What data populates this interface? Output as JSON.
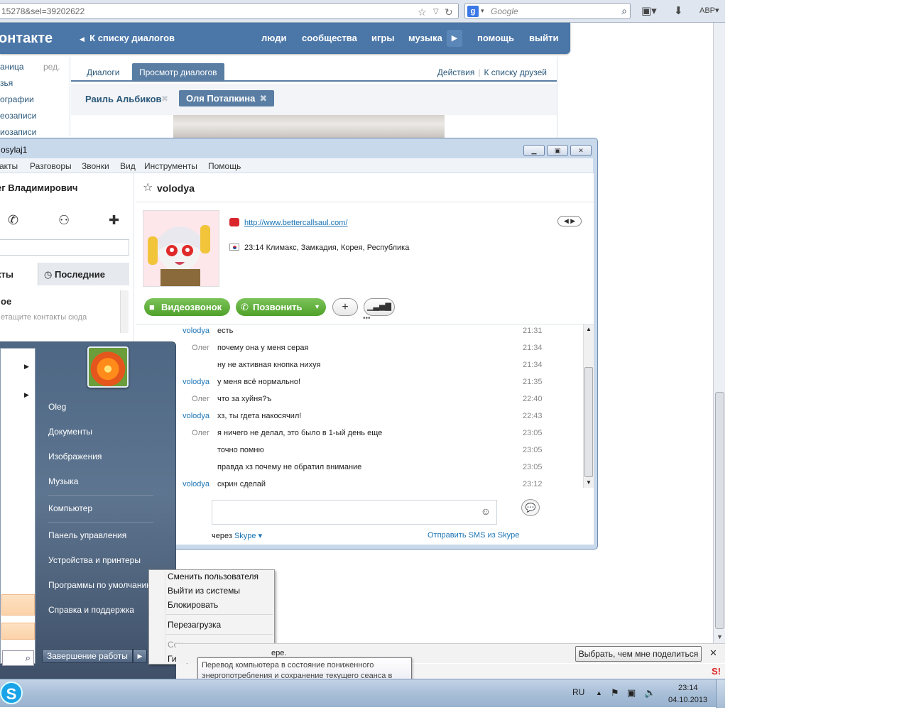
{
  "browser": {
    "url": "15278&sel=39202622",
    "search_placeholder": "Google",
    "search_engine_icon": "g"
  },
  "vk": {
    "logo": "онтакте",
    "back": "К списку диалогов",
    "nav": [
      "люди",
      "сообщества",
      "игры",
      "музыка",
      "помощь",
      "выйти"
    ],
    "left_menu": [
      "аница",
      "зья",
      "ографии",
      "еозаписи",
      "иозаписи"
    ],
    "edit": "ред.",
    "tabs": {
      "dialogs": "Диалоги",
      "view": "Просмотр диалогов"
    },
    "actions": "Действия",
    "friends": "К списку друзей",
    "people": [
      "Раиль Альбиков",
      "Оля Потапкина"
    ]
  },
  "skype": {
    "title": "osylaj1",
    "menu": [
      "акты",
      "Разговоры",
      "Звонки",
      "Вид",
      "Инструменты",
      "Помощь"
    ],
    "user": "ег Владимирович",
    "tabs": {
      "contacts": "кты",
      "recent": "Последние"
    },
    "favorites": "ое",
    "drag_hint": "етащите контакты сюда",
    "chat": {
      "name": "volodya",
      "url": "http://www.bettercallsaul.com/",
      "location": "23:14 Климакс, Замкадия, Корея, Республика",
      "video_btn": "Видеозвонок",
      "call_btn": "Позвонить",
      "messages": [
        {
          "author": "volodya",
          "text": "есть",
          "time": "21:31"
        },
        {
          "author": "Олег",
          "text": "почему она у меня серая",
          "time": "21:34"
        },
        {
          "author": "",
          "text": "ну не активная кнопка нихуя",
          "time": "21:34"
        },
        {
          "author": "volodya",
          "text": "у меня всё нормально!",
          "time": "21:35"
        },
        {
          "author": "Олег",
          "text": "что за хуйня?ъ",
          "time": "22:40"
        },
        {
          "author": "volodya",
          "text": "хз, ты гдета накосячил!",
          "time": "22:43"
        },
        {
          "author": "Олег",
          "text": "я ничего не делал, это было в 1-ый день еще",
          "time": "23:05"
        },
        {
          "author": "",
          "text": "точно помню",
          "time": "23:05"
        },
        {
          "author": "",
          "text": "правда хз почему не обратил внимание",
          "time": "23:05"
        },
        {
          "author": "volodya",
          "text": "скрин сделай",
          "time": "23:12"
        }
      ],
      "via": "через",
      "via_link": "Skype",
      "sms": "Отправить SMS из Skype"
    }
  },
  "start_menu": {
    "items": [
      "Oleg",
      "Документы",
      "Изображения",
      "Музыка",
      "Компьютер",
      "Панель управления",
      "Устройства и принтеры",
      "Программы по умолчанию",
      "Справка и поддержка"
    ],
    "shutdown": "Завершение работы"
  },
  "context_menu": {
    "items": [
      "Сменить пользователя",
      "Выйти из системы",
      "Блокировать",
      "Перезагрузка",
      "Сон",
      "Гиберна"
    ]
  },
  "tooltip": "Перевод компьютера в состояние пониженного энергопотребления и сохранение текущего сеанса в памяти, что позволяет быстро возобновить работу.",
  "notification": {
    "text": "ере.",
    "button": "Выбрать, чем мне поделиться"
  },
  "taskbar": {
    "lang": "RU",
    "time": "23:14",
    "date": "04.10.2013"
  }
}
